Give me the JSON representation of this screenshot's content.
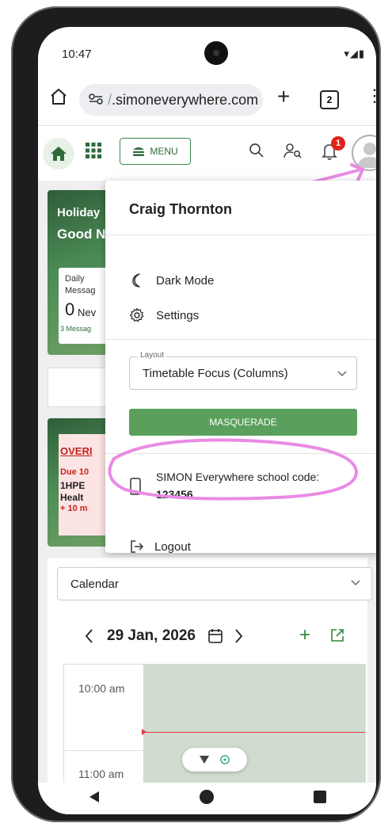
{
  "status_bar": {
    "time": "10:47",
    "icons": "▾◢▮"
  },
  "browser": {
    "url": ".simoneverywhere.com",
    "url_prefix": "/",
    "tab_count": "2",
    "home_icon": "home-outline-icon",
    "new_tab_icon": "plus-icon",
    "more_icon": "kebab-icon"
  },
  "app_header": {
    "menu_label": "MENU",
    "notification_count": "1"
  },
  "dashboard": {
    "holiday_title_line1": "Holiday",
    "holiday_title_line2": "Good N",
    "daily_label_1": "Daily",
    "daily_label_2": "Messag",
    "new_count": "0",
    "new_label": "Nev",
    "messages_sub": "3 Messag",
    "overdue_label": "OVERI",
    "due_label": "Due 10",
    "course_code": "1HPE",
    "course_name": "Healt",
    "extra_time": "+ 10 m"
  },
  "profile_menu": {
    "user_name": "Craig Thornton",
    "dark_mode": "Dark Mode",
    "settings": "Settings",
    "layout_label": "Layout",
    "layout_value": "Timetable Focus (Columns)",
    "masquerade": "MASQUERADE",
    "school_code_label": "SIMON Everywhere school code:",
    "school_code_value": "123456",
    "logout": "Logout"
  },
  "calendar": {
    "view_select": "Calendar",
    "date": "29 Jan, 2026",
    "time_1": "10:00 am",
    "time_2": "11:00 am"
  },
  "colors": {
    "accent_green": "#5aa05c",
    "brand_green": "#2e6b3a",
    "annotation_pink": "#e98be4",
    "badge_red": "#e2231a"
  }
}
